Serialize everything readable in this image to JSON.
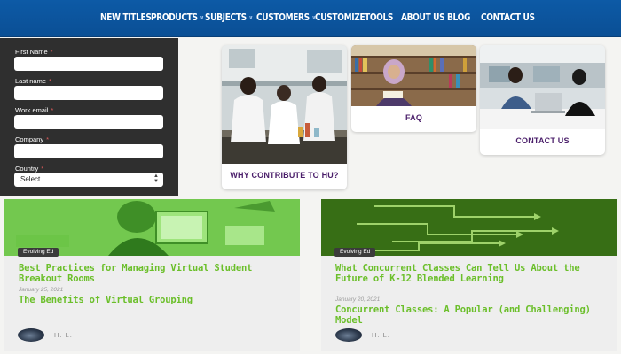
{
  "nav": {
    "items": [
      "NEW TITLES",
      "PRODUCTS",
      "SUBJECTS",
      "CUSTOMERS",
      "CUSTOMIZE",
      "TOOLS",
      "ABOUT US",
      "BLOG",
      "CONTACT US"
    ],
    "caret": "∨"
  },
  "form": {
    "required_mark": "*",
    "first_name_label": "First Name",
    "last_name_label": "Last name",
    "work_email_label": "Work email",
    "company_label": "Company",
    "country_label": "Country",
    "country_selected": "Select..."
  },
  "tiles": {
    "why_contribute": "WHY CONTRIBUTE TO HU?",
    "faq": "FAQ",
    "contact_us": "CONTACT US"
  },
  "posts": [
    {
      "badge": "Evolving Ed",
      "title": "Best Practices for Managing Virtual Student Breakout Rooms",
      "date": "January 25, 2021",
      "related_title": "The Benefits of Virtual Grouping",
      "author": "H. L."
    },
    {
      "badge": "Evolving Ed",
      "title": "What Concurrent Classes Can Tell Us About the Future of K-12 Blended Learning",
      "date": "January 20, 2021",
      "related_title": "Concurrent Classes: A Popular (and Challenging) Model",
      "author": "H. L."
    }
  ],
  "colors": {
    "nav_bg": "#0a4f95",
    "form_bg": "#2f2f2f",
    "tile_label": "#4a1e6a",
    "post_title": "#6bbf2a"
  }
}
